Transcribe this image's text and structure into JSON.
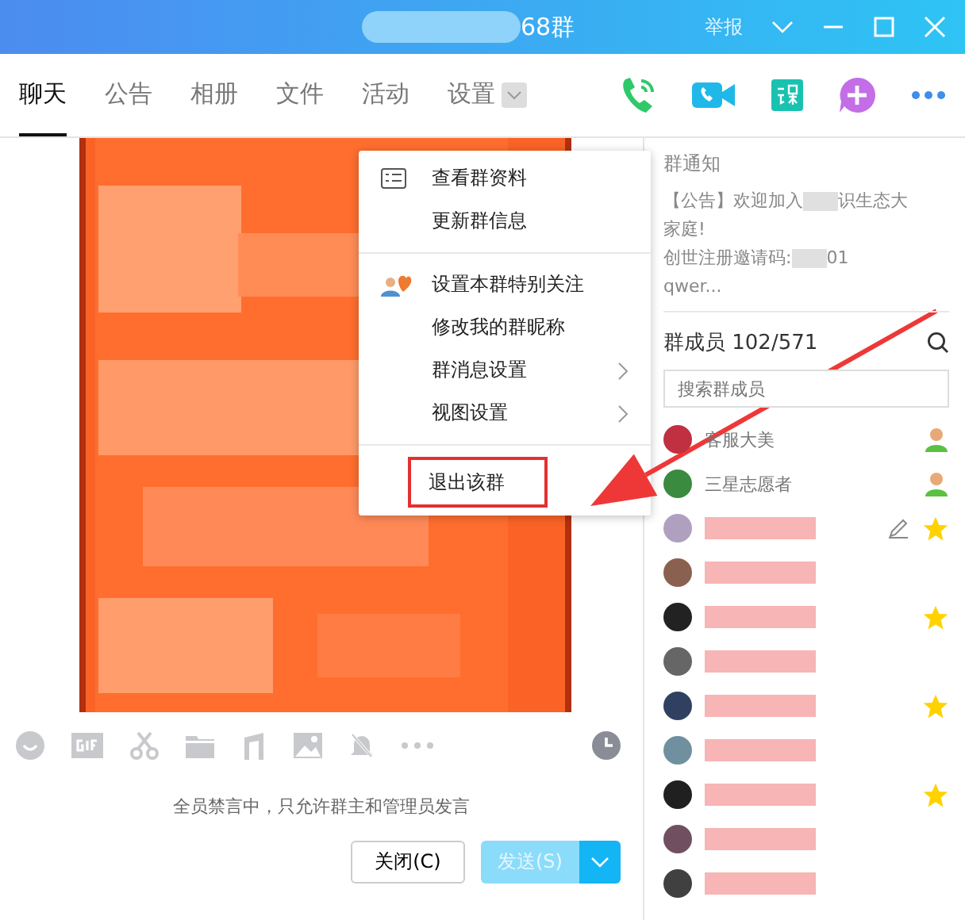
{
  "window": {
    "title": "68群",
    "report": "举报"
  },
  "tabs": [
    {
      "label": "聊天",
      "selected": true
    },
    {
      "label": "公告",
      "selected": false
    },
    {
      "label": "相册",
      "selected": false
    },
    {
      "label": "文件",
      "selected": false
    },
    {
      "label": "活动",
      "selected": false
    },
    {
      "label": "设置",
      "selected": false,
      "dropdown": true
    }
  ],
  "notice": {
    "heading": "群通知",
    "lines": [
      "【公告】欢迎加入",
      "识生态大",
      "家庭!",
      "创世注册邀请码:",
      "01",
      "qwer..."
    ]
  },
  "members": {
    "heading": "群成员 102/571",
    "search": {
      "placeholder": "搜索群成员"
    },
    "items": [
      {
        "name": "客服大美",
        "kind": "admin"
      },
      {
        "name": "三星志愿者",
        "kind": "admin"
      },
      {
        "kind": "star",
        "editable": true
      },
      {
        "kind": "plain"
      },
      {
        "kind": "star"
      },
      {
        "kind": "plain"
      },
      {
        "kind": "star"
      },
      {
        "kind": "plain"
      },
      {
        "kind": "star"
      },
      {
        "kind": "plain"
      },
      {
        "kind": "plain"
      }
    ]
  },
  "menu": {
    "groups": [
      [
        {
          "label": "查看群资料"
        },
        {
          "label": "更新群信息"
        }
      ],
      [
        {
          "label": "设置本群特别关注"
        },
        {
          "label": "修改我的群昵称"
        },
        {
          "label": "群消息设置",
          "submenu": true
        },
        {
          "label": "视图设置",
          "submenu": true
        }
      ],
      [
        {
          "label": "退出该群",
          "highlighted": true
        }
      ]
    ]
  },
  "input": {
    "notice": "全员禁言中，只允许群主和管理员发言",
    "close_button": "关闭(C)",
    "send_button": "发送(S)",
    "send_disabled": true
  }
}
